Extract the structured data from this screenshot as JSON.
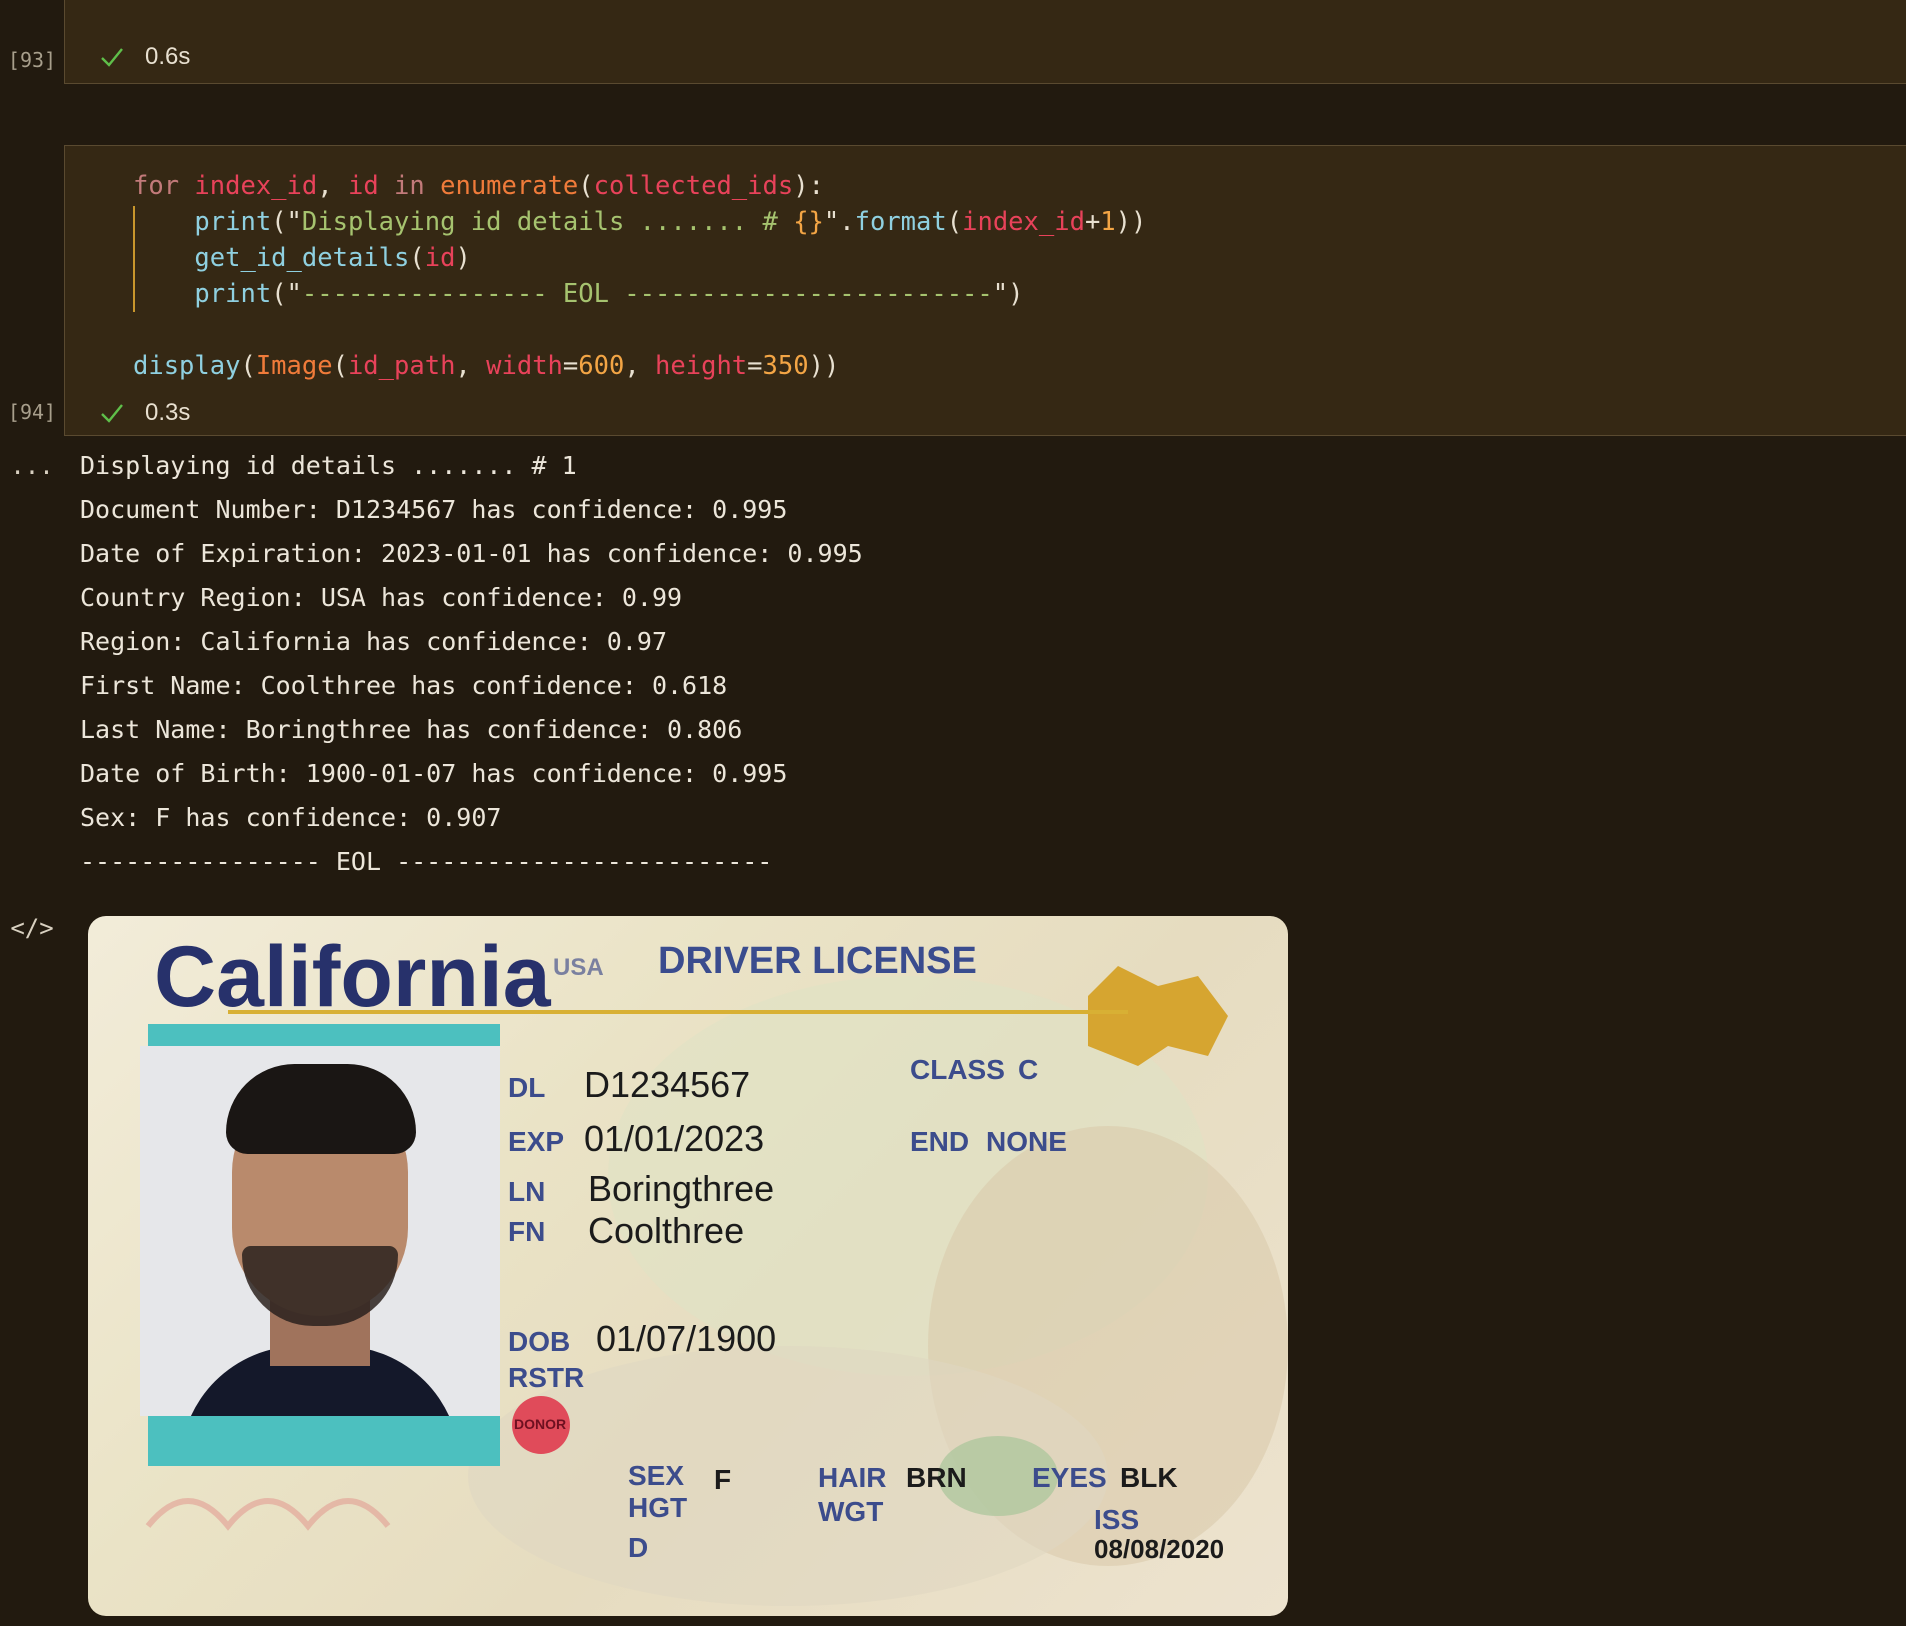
{
  "cells": [
    {
      "exec_count": "[93]",
      "duration": "0.6s"
    },
    {
      "exec_count": "[94]",
      "duration": "0.3s"
    }
  ],
  "code_lines": [
    {
      "tokens": [
        {
          "t": "for ",
          "c": "kw"
        },
        {
          "t": "index_id",
          "c": "var"
        },
        {
          "t": ", ",
          "c": "pun"
        },
        {
          "t": "id",
          "c": "var"
        },
        {
          "t": " in ",
          "c": "kw"
        },
        {
          "t": "enumerate",
          "c": "cls"
        },
        {
          "t": "(",
          "c": "pun"
        },
        {
          "t": "collected_ids",
          "c": "var"
        },
        {
          "t": "):",
          "c": "pun"
        }
      ]
    },
    {
      "tokens": [
        {
          "t": "    ",
          "c": "pun"
        },
        {
          "t": "print",
          "c": "fn"
        },
        {
          "t": "(\"",
          "c": "pun"
        },
        {
          "t": "Displaying id details ....... # ",
          "c": "str"
        },
        {
          "t": "{}",
          "c": "num"
        },
        {
          "t": "\".",
          "c": "pun"
        },
        {
          "t": "format",
          "c": "fn"
        },
        {
          "t": "(",
          "c": "pun"
        },
        {
          "t": "index_id",
          "c": "var"
        },
        {
          "t": "+",
          "c": "pun"
        },
        {
          "t": "1",
          "c": "num"
        },
        {
          "t": "))",
          "c": "pun"
        }
      ]
    },
    {
      "tokens": [
        {
          "t": "    ",
          "c": "pun"
        },
        {
          "t": "get_id_details",
          "c": "fn"
        },
        {
          "t": "(",
          "c": "pun"
        },
        {
          "t": "id",
          "c": "var"
        },
        {
          "t": ")",
          "c": "pun"
        }
      ]
    },
    {
      "tokens": [
        {
          "t": "    ",
          "c": "pun"
        },
        {
          "t": "print",
          "c": "fn"
        },
        {
          "t": "(\"",
          "c": "pun"
        },
        {
          "t": "---------------- EOL ------------------------",
          "c": "str"
        },
        {
          "t": "\")",
          "c": "pun"
        }
      ]
    },
    {
      "tokens": []
    },
    {
      "tokens": [
        {
          "t": "display",
          "c": "fn"
        },
        {
          "t": "(",
          "c": "pun"
        },
        {
          "t": "Image",
          "c": "cls"
        },
        {
          "t": "(",
          "c": "pun"
        },
        {
          "t": "id_path",
          "c": "var"
        },
        {
          "t": ", ",
          "c": "pun"
        },
        {
          "t": "width",
          "c": "var"
        },
        {
          "t": "=",
          "c": "pun"
        },
        {
          "t": "600",
          "c": "num"
        },
        {
          "t": ", ",
          "c": "pun"
        },
        {
          "t": "height",
          "c": "var"
        },
        {
          "t": "=",
          "c": "pun"
        },
        {
          "t": "350",
          "c": "num"
        },
        {
          "t": "))",
          "c": "pun"
        }
      ]
    }
  ],
  "output": {
    "marker": "...",
    "image_marker": "</>",
    "lines": [
      "Displaying id details ....... # 1",
      "Document Number: D1234567 has confidence: 0.995",
      "Date of Expiration: 2023-01-01 has confidence: 0.995",
      "Country Region: USA has confidence: 0.99",
      "Region: California has confidence: 0.97",
      "First Name: Coolthree has confidence: 0.618",
      "Last Name: Boringthree has confidence: 0.806",
      "Date of Birth: 1900-01-07 has confidence: 0.995",
      "Sex: F has confidence: 0.907",
      "---------------- EOL -------------------------"
    ]
  },
  "id_card": {
    "state": "California",
    "country": "USA",
    "title": "DRIVER LICENSE",
    "dl_label": "DL",
    "dl_value": "D1234567",
    "exp_label": "EXP",
    "exp_value": "01/01/2023",
    "ln_label": "LN",
    "ln_value": "Boringthree",
    "fn_label": "FN",
    "fn_value": "Coolthree",
    "dob_label": "DOB",
    "dob_value": "01/07/1900",
    "rstr_label": "RSTR",
    "donor_label": "DONOR",
    "class_label": "CLASS",
    "class_value": "C",
    "end_label": "END",
    "end_value": "NONE",
    "sex_label": "SEX",
    "sex_value": "F",
    "hgt_label": "HGT",
    "d_label": "D",
    "hair_label": "HAIR",
    "hair_value": "BRN",
    "wgt_label": "WGT",
    "eyes_label": "EYES",
    "eyes_value": "BLK",
    "iss_label": "ISS",
    "iss_value": "08/08/2020"
  }
}
